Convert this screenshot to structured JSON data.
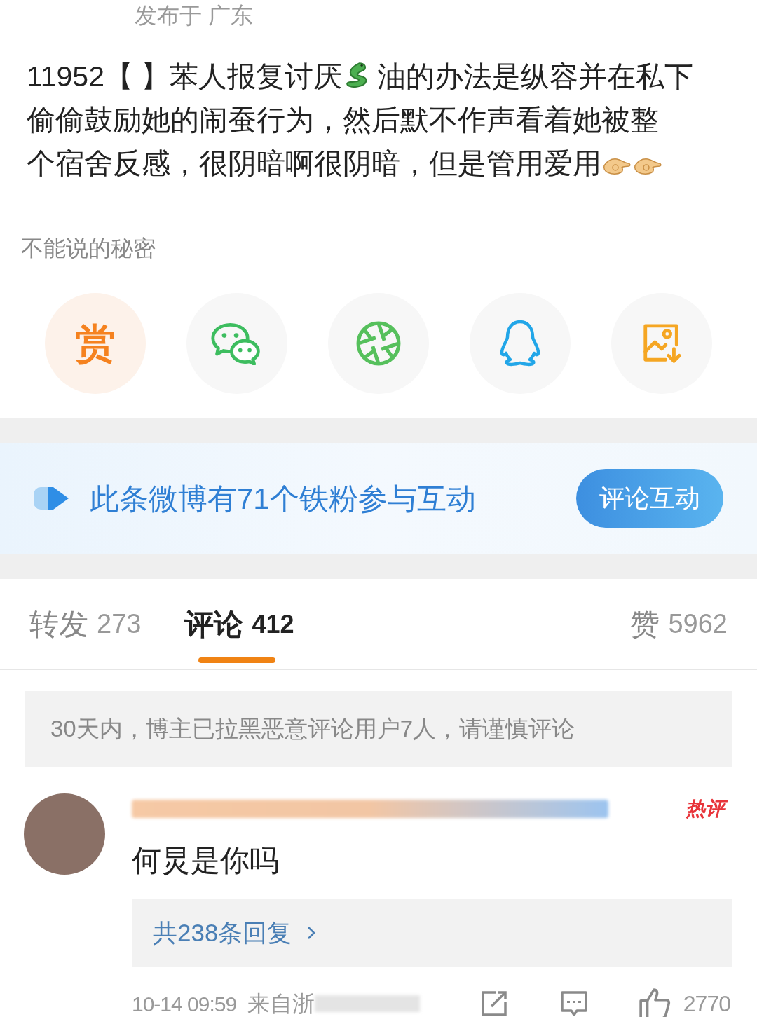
{
  "post": {
    "location": "发布于 广东",
    "text_lines": [
      [
        {
          "kind": "text",
          "text": "11952【 】苯人报复讨厌"
        },
        {
          "kind": "snake"
        },
        {
          "kind": "text",
          "text": "油的办法是纵容并在私下"
        }
      ],
      [
        {
          "kind": "text",
          "text": "偷偷鼓励她的闹蚕行为，然后默不作声看着她被整"
        }
      ],
      [
        {
          "kind": "text",
          "text": "个宿舍反感，很阴暗啊很阴暗，但是管用爱用"
        },
        {
          "kind": "hand"
        },
        {
          "kind": "hand"
        }
      ]
    ],
    "topic": "不能说的秘密"
  },
  "share_buttons": [
    {
      "kind": "reward",
      "label": "赏"
    },
    {
      "kind": "wechat"
    },
    {
      "kind": "moments"
    },
    {
      "kind": "qq"
    },
    {
      "kind": "save_image"
    }
  ],
  "fans_banner": {
    "text": "此条微博有71个铁粉参与互动",
    "button": "评论互动"
  },
  "tabs": [
    {
      "label": "转发",
      "count": "273",
      "selected": false
    },
    {
      "label": "评论",
      "count": "412",
      "selected": true
    },
    {
      "label": "赞",
      "count": "5962",
      "selected": false
    }
  ],
  "notice": "30天内，博主已拉黑恶意评论用户7人，请谨慎评论",
  "comments": [
    {
      "badge": "热评",
      "text": "何炅是你吗",
      "replies": "共238条回复",
      "time": "10-14 09:59",
      "source": "来自浙",
      "likes": "2770"
    }
  ]
}
